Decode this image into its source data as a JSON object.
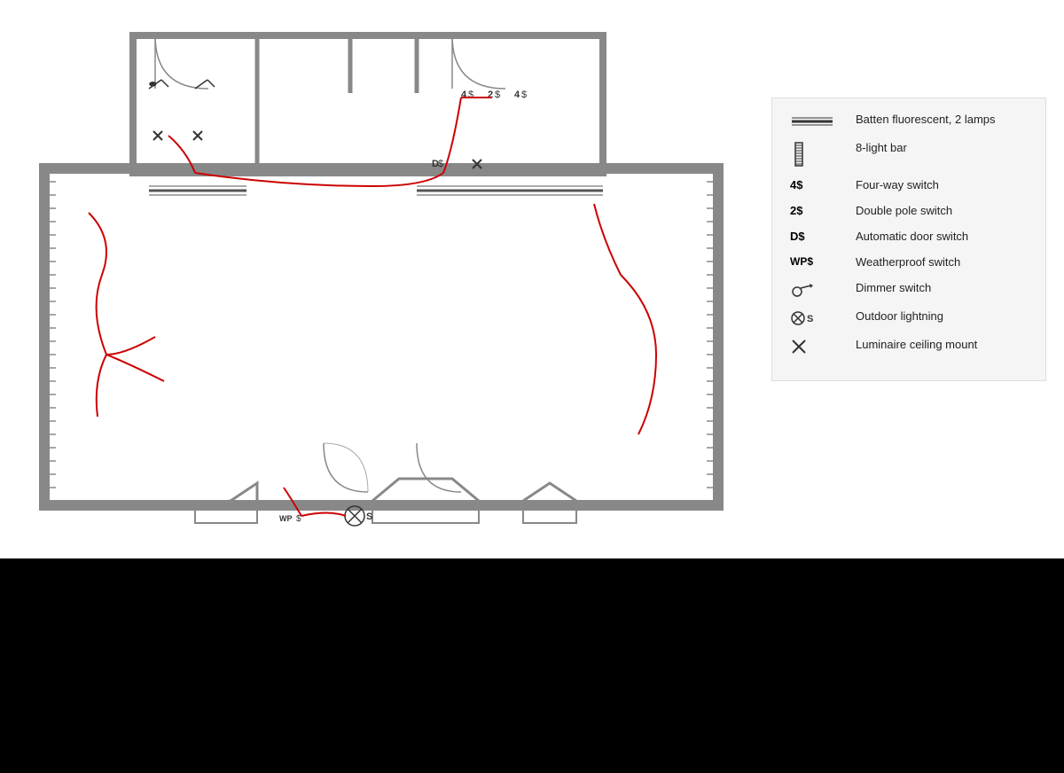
{
  "legend": {
    "items": [
      {
        "id": "batten",
        "symbol": "batten",
        "label": "Batten fluorescent, 2 lamps"
      },
      {
        "id": "lightbar",
        "symbol": "lightbar",
        "label": "8-light bar"
      },
      {
        "id": "fourway",
        "symbol": "4$",
        "label": "Four-way switch"
      },
      {
        "id": "doublepole",
        "symbol": "2$",
        "label": "Double pole switch"
      },
      {
        "id": "autodoor",
        "symbol": "D$",
        "label": "Automatic door switch"
      },
      {
        "id": "weatherproof",
        "symbol": "WP$",
        "label": "Weatherproof switch"
      },
      {
        "id": "dimmer",
        "symbol": "dimmer",
        "label": "Dimmer switch"
      },
      {
        "id": "outdoor",
        "symbol": "⊗S",
        "label": "Outdoor lightning"
      },
      {
        "id": "luminaire",
        "symbol": "✕",
        "label": "Luminaire ceiling mount"
      }
    ]
  }
}
